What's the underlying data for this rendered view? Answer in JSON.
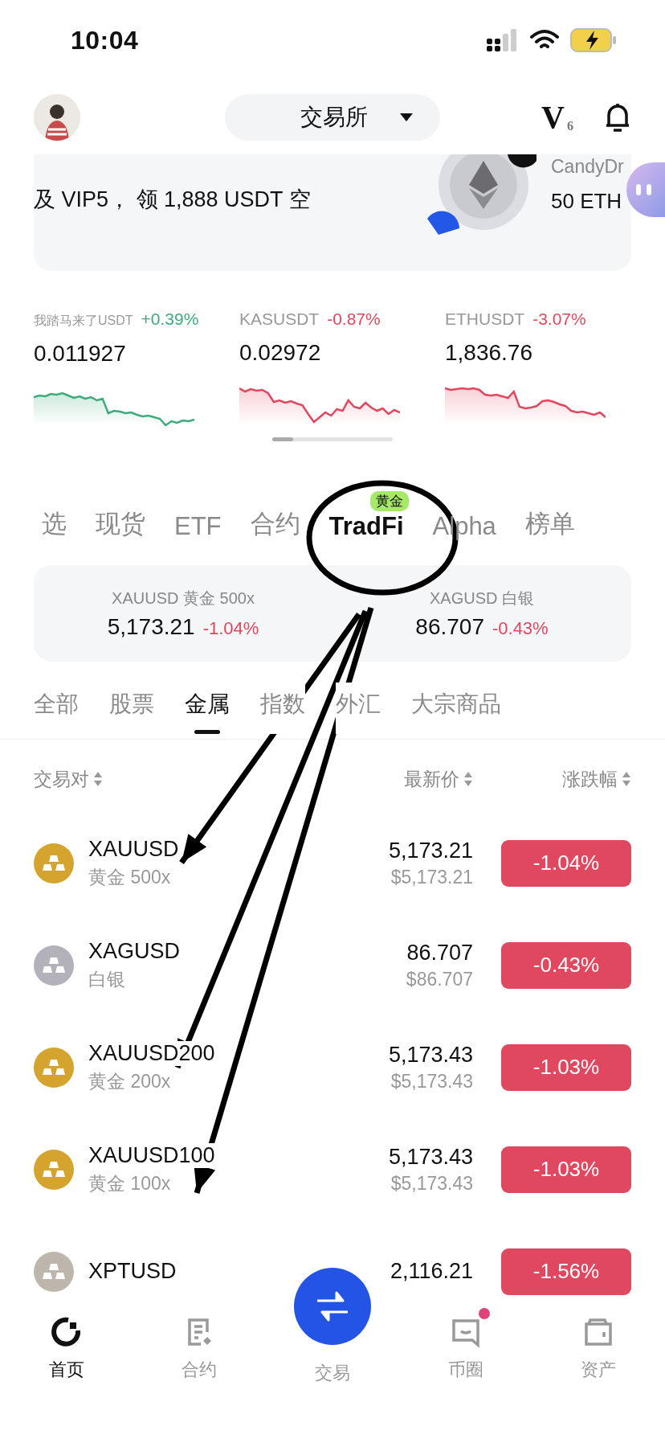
{
  "status_bar": {
    "time": "10:04"
  },
  "header": {
    "exchange_selector": "交易所",
    "vip_badge": {
      "letter": "V",
      "level": "6"
    }
  },
  "banner": {
    "text": "及 VIP5， 领 1,888 USDT 空",
    "reward_name": "CandyDr",
    "reward_amount": "50 ETH"
  },
  "tickers": [
    {
      "pair": "我踏马来了USDT",
      "change": "+0.39%",
      "color": "#3dab7b",
      "price": "0.011927"
    },
    {
      "pair": "KASUSDT",
      "change": "-0.87%",
      "color": "#e0485f",
      "price": "0.02972"
    },
    {
      "pair": "ETHUSDT",
      "change": "-3.07%",
      "color": "#e0485f",
      "price": "1,836.76"
    }
  ],
  "market_tabs": [
    {
      "label": "选",
      "selected": false
    },
    {
      "label": "现货",
      "selected": false
    },
    {
      "label": "ETF",
      "selected": false
    },
    {
      "label": "合约",
      "selected": false
    },
    {
      "label": "TradFi",
      "selected": true,
      "badge": "黄金"
    },
    {
      "label": "Alpha",
      "selected": false
    },
    {
      "label": "榜单",
      "selected": false
    }
  ],
  "featured": [
    {
      "title": "XAUUSD 黄金 500x",
      "price": "5,173.21",
      "change": "-1.04%",
      "color": "#e0485f"
    },
    {
      "title": "XAGUSD 白银",
      "price": "86.707",
      "change": "-0.43%",
      "color": "#e0485f"
    }
  ],
  "category_tabs": [
    {
      "label": "全部",
      "selected": false
    },
    {
      "label": "股票",
      "selected": false
    },
    {
      "label": "金属",
      "selected": true
    },
    {
      "label": "指数",
      "selected": false
    },
    {
      "label": "外汇",
      "selected": false
    },
    {
      "label": "大宗商品",
      "selected": false
    }
  ],
  "table": {
    "columns": [
      "交易对",
      "最新价",
      "涨跌幅"
    ],
    "rows": [
      {
        "symbol": "XAUUSD",
        "subtitle": "黄金 500x",
        "color": "#d4a42e",
        "price": "5,173.21",
        "usd_price": "$5,173.21",
        "change": "-1.04%"
      },
      {
        "symbol": "XAGUSD",
        "subtitle": "白银",
        "color": "#b3b2bb",
        "price": "86.707",
        "usd_price": "$86.707",
        "change": "-0.43%"
      },
      {
        "symbol": "XAUUSD200",
        "subtitle": "黄金 200x",
        "color": "#d4a42e",
        "price": "5,173.43",
        "usd_price": "$5,173.43",
        "change": "-1.03%"
      },
      {
        "symbol": "XAUUSD100",
        "subtitle": "黄金 100x",
        "color": "#d4a42e",
        "price": "5,173.43",
        "usd_price": "$5,173.43",
        "change": "-1.03%"
      },
      {
        "symbol": "XPTUSD",
        "color": "#bdb6ad",
        "price": "2,116.21",
        "change": "-1.56%"
      }
    ]
  },
  "bottom_nav": [
    {
      "label": "首页",
      "kind": "tab",
      "selected": true,
      "notification": false
    },
    {
      "label": "合约",
      "kind": "tab",
      "selected": false,
      "notification": false
    },
    {
      "label": "交易",
      "kind": "action",
      "selected": false,
      "notification": false
    },
    {
      "label": "币圈",
      "kind": "tab",
      "selected": false,
      "notification": true
    },
    {
      "label": "资产",
      "kind": "tab",
      "selected": false,
      "notification": false
    }
  ]
}
